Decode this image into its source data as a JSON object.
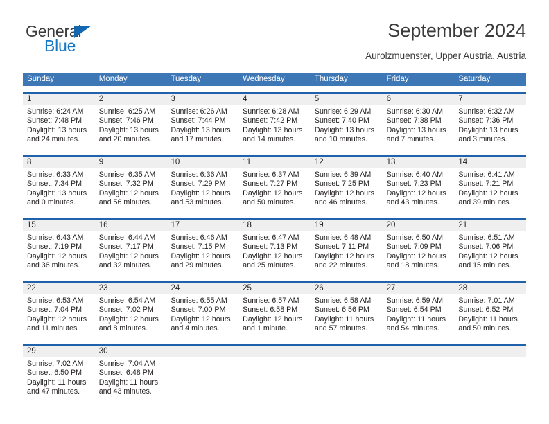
{
  "brand": {
    "name_dark": "General",
    "name_blue": "Blue",
    "triangle_color": "#1367b0",
    "blue_color": "#1878c4",
    "dark_color": "#3b3b3d"
  },
  "header": {
    "title": "September 2024",
    "subtitle": "Aurolzmuenster, Upper Austria, Austria"
  },
  "theme": {
    "header_blue": "#3d77b5",
    "rule_blue": "#1f62ab",
    "daynum_gray": "#efefef",
    "text": "#231f20"
  },
  "weekdays": [
    "Sunday",
    "Monday",
    "Tuesday",
    "Wednesday",
    "Thursday",
    "Friday",
    "Saturday"
  ],
  "weeks": [
    [
      {
        "day": "1",
        "sunrise": "Sunrise: 6:24 AM",
        "sunset": "Sunset: 7:48 PM",
        "daylight1": "Daylight: 13 hours",
        "daylight2": "and 24 minutes."
      },
      {
        "day": "2",
        "sunrise": "Sunrise: 6:25 AM",
        "sunset": "Sunset: 7:46 PM",
        "daylight1": "Daylight: 13 hours",
        "daylight2": "and 20 minutes."
      },
      {
        "day": "3",
        "sunrise": "Sunrise: 6:26 AM",
        "sunset": "Sunset: 7:44 PM",
        "daylight1": "Daylight: 13 hours",
        "daylight2": "and 17 minutes."
      },
      {
        "day": "4",
        "sunrise": "Sunrise: 6:28 AM",
        "sunset": "Sunset: 7:42 PM",
        "daylight1": "Daylight: 13 hours",
        "daylight2": "and 14 minutes."
      },
      {
        "day": "5",
        "sunrise": "Sunrise: 6:29 AM",
        "sunset": "Sunset: 7:40 PM",
        "daylight1": "Daylight: 13 hours",
        "daylight2": "and 10 minutes."
      },
      {
        "day": "6",
        "sunrise": "Sunrise: 6:30 AM",
        "sunset": "Sunset: 7:38 PM",
        "daylight1": "Daylight: 13 hours",
        "daylight2": "and 7 minutes."
      },
      {
        "day": "7",
        "sunrise": "Sunrise: 6:32 AM",
        "sunset": "Sunset: 7:36 PM",
        "daylight1": "Daylight: 13 hours",
        "daylight2": "and 3 minutes."
      }
    ],
    [
      {
        "day": "8",
        "sunrise": "Sunrise: 6:33 AM",
        "sunset": "Sunset: 7:34 PM",
        "daylight1": "Daylight: 13 hours",
        "daylight2": "and 0 minutes."
      },
      {
        "day": "9",
        "sunrise": "Sunrise: 6:35 AM",
        "sunset": "Sunset: 7:32 PM",
        "daylight1": "Daylight: 12 hours",
        "daylight2": "and 56 minutes."
      },
      {
        "day": "10",
        "sunrise": "Sunrise: 6:36 AM",
        "sunset": "Sunset: 7:29 PM",
        "daylight1": "Daylight: 12 hours",
        "daylight2": "and 53 minutes."
      },
      {
        "day": "11",
        "sunrise": "Sunrise: 6:37 AM",
        "sunset": "Sunset: 7:27 PM",
        "daylight1": "Daylight: 12 hours",
        "daylight2": "and 50 minutes."
      },
      {
        "day": "12",
        "sunrise": "Sunrise: 6:39 AM",
        "sunset": "Sunset: 7:25 PM",
        "daylight1": "Daylight: 12 hours",
        "daylight2": "and 46 minutes."
      },
      {
        "day": "13",
        "sunrise": "Sunrise: 6:40 AM",
        "sunset": "Sunset: 7:23 PM",
        "daylight1": "Daylight: 12 hours",
        "daylight2": "and 43 minutes."
      },
      {
        "day": "14",
        "sunrise": "Sunrise: 6:41 AM",
        "sunset": "Sunset: 7:21 PM",
        "daylight1": "Daylight: 12 hours",
        "daylight2": "and 39 minutes."
      }
    ],
    [
      {
        "day": "15",
        "sunrise": "Sunrise: 6:43 AM",
        "sunset": "Sunset: 7:19 PM",
        "daylight1": "Daylight: 12 hours",
        "daylight2": "and 36 minutes."
      },
      {
        "day": "16",
        "sunrise": "Sunrise: 6:44 AM",
        "sunset": "Sunset: 7:17 PM",
        "daylight1": "Daylight: 12 hours",
        "daylight2": "and 32 minutes."
      },
      {
        "day": "17",
        "sunrise": "Sunrise: 6:46 AM",
        "sunset": "Sunset: 7:15 PM",
        "daylight1": "Daylight: 12 hours",
        "daylight2": "and 29 minutes."
      },
      {
        "day": "18",
        "sunrise": "Sunrise: 6:47 AM",
        "sunset": "Sunset: 7:13 PM",
        "daylight1": "Daylight: 12 hours",
        "daylight2": "and 25 minutes."
      },
      {
        "day": "19",
        "sunrise": "Sunrise: 6:48 AM",
        "sunset": "Sunset: 7:11 PM",
        "daylight1": "Daylight: 12 hours",
        "daylight2": "and 22 minutes."
      },
      {
        "day": "20",
        "sunrise": "Sunrise: 6:50 AM",
        "sunset": "Sunset: 7:09 PM",
        "daylight1": "Daylight: 12 hours",
        "daylight2": "and 18 minutes."
      },
      {
        "day": "21",
        "sunrise": "Sunrise: 6:51 AM",
        "sunset": "Sunset: 7:06 PM",
        "daylight1": "Daylight: 12 hours",
        "daylight2": "and 15 minutes."
      }
    ],
    [
      {
        "day": "22",
        "sunrise": "Sunrise: 6:53 AM",
        "sunset": "Sunset: 7:04 PM",
        "daylight1": "Daylight: 12 hours",
        "daylight2": "and 11 minutes."
      },
      {
        "day": "23",
        "sunrise": "Sunrise: 6:54 AM",
        "sunset": "Sunset: 7:02 PM",
        "daylight1": "Daylight: 12 hours",
        "daylight2": "and 8 minutes."
      },
      {
        "day": "24",
        "sunrise": "Sunrise: 6:55 AM",
        "sunset": "Sunset: 7:00 PM",
        "daylight1": "Daylight: 12 hours",
        "daylight2": "and 4 minutes."
      },
      {
        "day": "25",
        "sunrise": "Sunrise: 6:57 AM",
        "sunset": "Sunset: 6:58 PM",
        "daylight1": "Daylight: 12 hours",
        "daylight2": "and 1 minute."
      },
      {
        "day": "26",
        "sunrise": "Sunrise: 6:58 AM",
        "sunset": "Sunset: 6:56 PM",
        "daylight1": "Daylight: 11 hours",
        "daylight2": "and 57 minutes."
      },
      {
        "day": "27",
        "sunrise": "Sunrise: 6:59 AM",
        "sunset": "Sunset: 6:54 PM",
        "daylight1": "Daylight: 11 hours",
        "daylight2": "and 54 minutes."
      },
      {
        "day": "28",
        "sunrise": "Sunrise: 7:01 AM",
        "sunset": "Sunset: 6:52 PM",
        "daylight1": "Daylight: 11 hours",
        "daylight2": "and 50 minutes."
      }
    ],
    [
      {
        "day": "29",
        "sunrise": "Sunrise: 7:02 AM",
        "sunset": "Sunset: 6:50 PM",
        "daylight1": "Daylight: 11 hours",
        "daylight2": "and 47 minutes."
      },
      {
        "day": "30",
        "sunrise": "Sunrise: 7:04 AM",
        "sunset": "Sunset: 6:48 PM",
        "daylight1": "Daylight: 11 hours",
        "daylight2": "and 43 minutes."
      },
      {
        "day": "",
        "sunrise": "",
        "sunset": "",
        "daylight1": "",
        "daylight2": ""
      },
      {
        "day": "",
        "sunrise": "",
        "sunset": "",
        "daylight1": "",
        "daylight2": ""
      },
      {
        "day": "",
        "sunrise": "",
        "sunset": "",
        "daylight1": "",
        "daylight2": ""
      },
      {
        "day": "",
        "sunrise": "",
        "sunset": "",
        "daylight1": "",
        "daylight2": ""
      },
      {
        "day": "",
        "sunrise": "",
        "sunset": "",
        "daylight1": "",
        "daylight2": ""
      }
    ]
  ]
}
